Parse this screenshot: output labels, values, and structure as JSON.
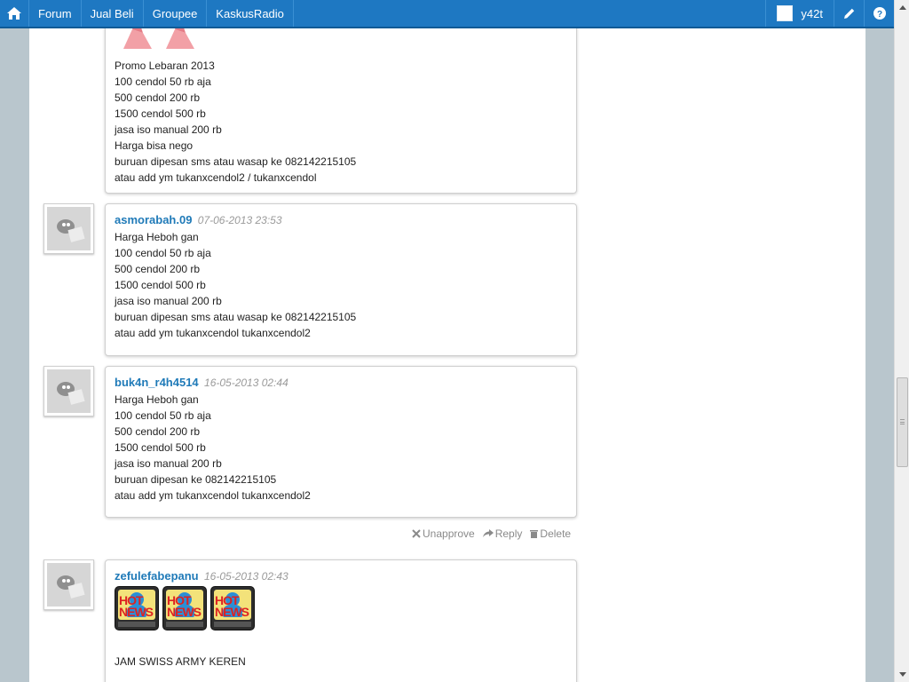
{
  "nav": {
    "items": [
      "Forum",
      "Jual Beli",
      "Groupee",
      "KaskusRadio"
    ],
    "username": "y42t"
  },
  "posts": [
    {
      "lines": [
        "Promo Lebaran 2013",
        "100 cendol 50 rb aja",
        "500 cendol 200 rb",
        "1500 cendol 500 rb",
        "jasa iso manual 200 rb",
        "Harga bisa nego",
        "buruan dipesan sms atau wasap ke 082142215105",
        "atau add ym tukanxcendol2 / tukanxcendol"
      ]
    },
    {
      "user": "asmorabah.09",
      "time": "07-06-2013 23:53",
      "lines": [
        "Harga Heboh gan",
        "100 cendol 50 rb aja",
        "500 cendol 200 rb",
        "1500 cendol 500 rb",
        "jasa iso manual 200 rb",
        "buruan dipesan sms atau wasap ke 082142215105",
        "atau add ym tukanxcendol tukanxcendol2"
      ]
    },
    {
      "user": "buk4n_r4h4514",
      "time": "16-05-2013 02:44",
      "lines": [
        "Harga Heboh gan",
        "100 cendol 50 rb aja",
        "500 cendol 200 rb",
        "1500 cendol 500 rb",
        "jasa iso manual 200 rb",
        "buruan dipesan ke 082142215105",
        "atau add ym tukanxcendol tukanxcendol2"
      ]
    },
    {
      "user": "zefulefabepanu",
      "time": "16-05-2013 02:43",
      "lines": [
        "JAM SWISS ARMY KEREN"
      ]
    }
  ],
  "actions": {
    "unapprove": "Unapprove",
    "reply": "Reply",
    "delete": "Delete"
  },
  "badge": {
    "text": "HOT NEWS"
  },
  "icons": [
    "home-icon",
    "pencil-icon",
    "help-icon",
    "close-icon",
    "reply-icon",
    "trash-icon"
  ],
  "colors": {
    "navbar": "#1e78c2",
    "username_link": "#1f7ab8",
    "timestamp": "#9a9a9a",
    "page_bg": "#b9c6cd"
  }
}
